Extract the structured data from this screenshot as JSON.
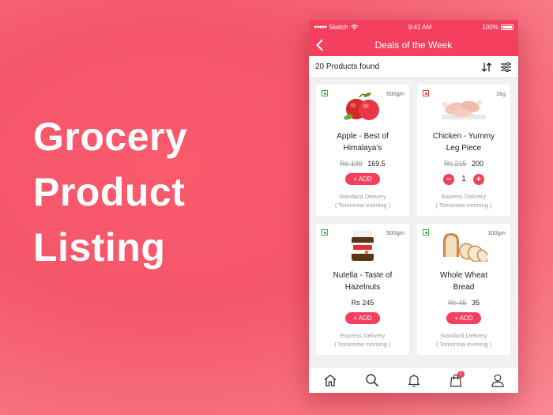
{
  "headline": [
    "Grocery",
    "Product",
    "Listing"
  ],
  "status": {
    "carrier": "Sketch",
    "time": "9:41 AM",
    "battery": "100%"
  },
  "nav": {
    "title": "Deals of the Week",
    "back_icon": "chevron-left-icon"
  },
  "filter": {
    "count_label": "20 Products found",
    "sort_icon": "sort-icon",
    "filter_icon": "filter-sliders-icon"
  },
  "products": [
    {
      "name_line1": "Apple - Best of",
      "name_line2": "Himalaya’s",
      "weight": "500gm",
      "type": "veg",
      "old_price": "Rs 199",
      "price": "169.5",
      "action": "add",
      "add_label": "+ ADD",
      "delivery1": "Standard Delivery",
      "delivery2": "( Tomorrow evening )"
    },
    {
      "name_line1": "Chicken - Yummy",
      "name_line2": "Leg Piece",
      "weight": "1kg",
      "type": "nonveg",
      "old_price": "Rs 215",
      "price": "200",
      "action": "stepper",
      "qty": "1",
      "delivery1": "Express Delivery",
      "delivery2": "( Tomorrow morning )"
    },
    {
      "name_line1": "Nutella - Taste of",
      "name_line2": "Hazelnuts",
      "weight": "500gm",
      "type": "veg",
      "price_single": "Rs 245",
      "action": "add",
      "add_label": "+ ADD",
      "delivery1": "Express Delivery",
      "delivery2": "( Tomorrow morning )"
    },
    {
      "name_line1": "Whole Wheat",
      "name_line2": "Bread",
      "weight": "100gm",
      "type": "veg",
      "old_price": "Rs 45",
      "price": "35",
      "action": "add",
      "add_label": "+ ADD",
      "delivery1": "Standard Delivery",
      "delivery2": "( Tomorrow evening )"
    }
  ],
  "tabbar": {
    "items": [
      "home-icon",
      "search-icon",
      "bell-icon",
      "cart-icon",
      "user-icon"
    ],
    "cart_badge": "2"
  },
  "colors": {
    "accent": "#f43f5e",
    "veg": "#3cb043",
    "nonveg": "#e53935"
  }
}
